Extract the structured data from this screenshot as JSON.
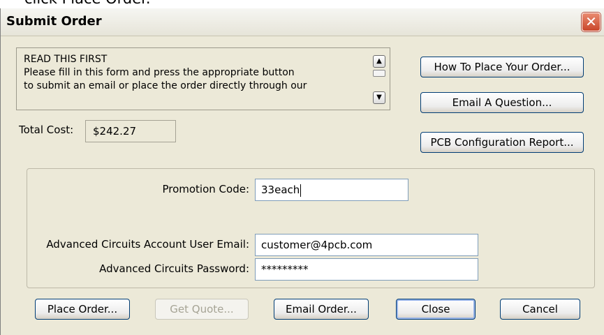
{
  "top_text": "click Place Order.",
  "window": {
    "title": "Submit Order",
    "close_glyph": "✕"
  },
  "read_box": {
    "lines": [
      "READ THIS FIRST",
      "Please fill in this form and press the appropriate button",
      "to submit an email or place the order directly through our"
    ],
    "scroll_up_icon": "up-arrow-icon",
    "scroll_down_icon": "down-arrow-icon"
  },
  "side_buttons": {
    "how_to": "How To Place Your Order...",
    "email_question": "Email A Question...",
    "pcb_report": "PCB Configuration Report..."
  },
  "total_cost": {
    "label": "Total Cost:",
    "value": "$242.27"
  },
  "form": {
    "promo_label": "Promotion Code:",
    "promo_value": "33each",
    "email_label": "Advanced Circuits Account User Email:",
    "email_value": "customer@4pcb.com",
    "password_label": "Advanced Circuits Password:",
    "password_value": "*********"
  },
  "bottom_buttons": {
    "place_order": "Place Order...",
    "get_quote": "Get Quote...",
    "email_order": "Email Order...",
    "close": "Close",
    "cancel": "Cancel"
  }
}
